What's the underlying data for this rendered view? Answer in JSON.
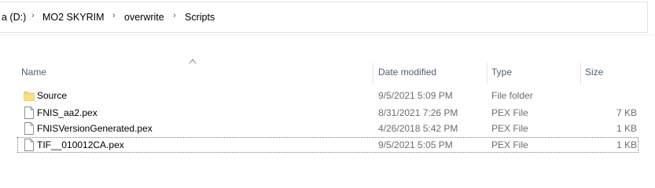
{
  "breadcrumb": {
    "segments": [
      "a (D:)",
      "MO2 SKYRIM",
      "overwrite",
      "Scripts"
    ],
    "separator": "›"
  },
  "icons": {
    "folder": "folder-icon",
    "file": "file-icon",
    "chevron": "chevron-right-icon",
    "sort": "sort-up-caret-icon"
  },
  "columns": {
    "name": "Name",
    "date": "Date modified",
    "type": "Type",
    "size": "Size"
  },
  "rows": [
    {
      "icon": "folder",
      "name": "Source",
      "date": "9/5/2021 5:09 PM",
      "type": "File folder",
      "size": ""
    },
    {
      "icon": "file",
      "name": "FNIS_aa2.pex",
      "date": "8/31/2021 7:26 PM",
      "type": "PEX File",
      "size": "7 KB"
    },
    {
      "icon": "file",
      "name": "FNISVersionGenerated.pex",
      "date": "4/26/2018 5:42 PM",
      "type": "PEX File",
      "size": "1 KB"
    },
    {
      "icon": "file",
      "name": "TIF__010012CA.pex",
      "date": "9/5/2021 5:05 PM",
      "type": "PEX File",
      "size": "1 KB"
    }
  ],
  "colors": {
    "header_text": "#4c607a",
    "folder_yellow": "#f8d775",
    "secondary_text": "#6d6d6d"
  }
}
